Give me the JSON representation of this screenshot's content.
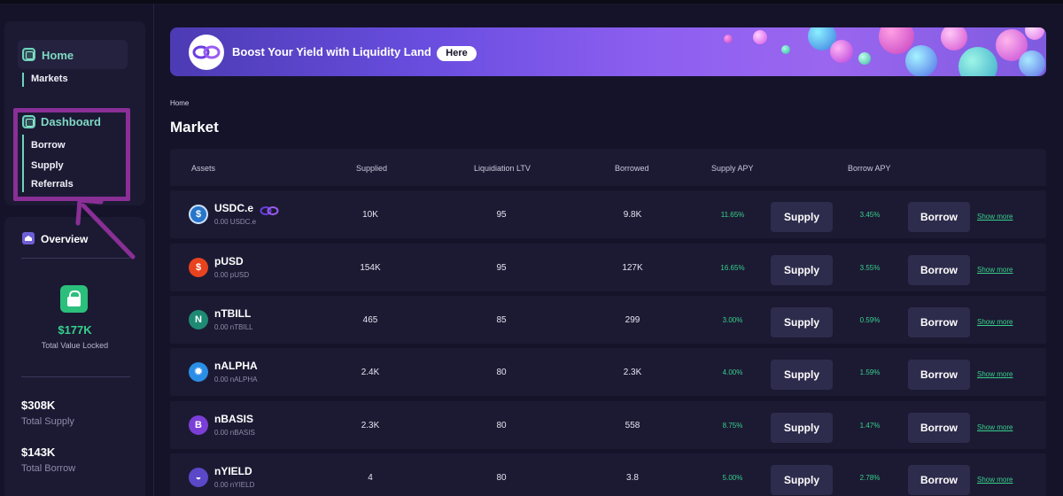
{
  "sidebar": {
    "nav": {
      "home_label": "Home",
      "markets_label": "Markets",
      "dashboard_label": "Dashboard",
      "borrow_label": "Borrow",
      "supply_label": "Supply",
      "referrals_label": "Referrals"
    },
    "overview": {
      "title": "Overview",
      "tvl_value": "$177K",
      "tvl_label": "Total Value Locked",
      "total_supply_value": "$308K",
      "total_supply_label": "Total Supply",
      "total_borrow_value": "$143K",
      "total_borrow_label": "Total Borrow"
    }
  },
  "banner": {
    "text": "Boost Your Yield with Liquidity Land",
    "button_label": "Here"
  },
  "breadcrumb": "Home",
  "page_title": "Market",
  "table": {
    "headers": {
      "assets": "Assets",
      "supplied": "Supplied",
      "ltv": "Liquidiation LTV",
      "borrowed": "Borrowed",
      "supply_apy": "Supply APY",
      "borrow_apy": "Borrow APY"
    },
    "supply_btn": "Supply",
    "borrow_btn": "Borrow",
    "show_more": "Show more",
    "rows": [
      {
        "name": "USDC.e",
        "balance": "0.00 USDC.e",
        "supplied": "10K",
        "ltv": "95",
        "borrowed": "9.8K",
        "supply_apy": "11.65%",
        "borrow_apy": "3.45%",
        "icon": "usdc-icon",
        "color": "#2775ca"
      },
      {
        "name": "pUSD",
        "balance": "0.00 pUSD",
        "supplied": "154K",
        "ltv": "95",
        "borrowed": "127K",
        "supply_apy": "16.65%",
        "borrow_apy": "3.55%",
        "icon": "dollar-icon",
        "color": "#e8431f"
      },
      {
        "name": "nTBILL",
        "balance": "0.00 nTBILL",
        "supplied": "465",
        "ltv": "85",
        "borrowed": "299",
        "supply_apy": "3.00%",
        "borrow_apy": "0.59%",
        "icon": "nest-icon",
        "color": "#1f8a74"
      },
      {
        "name": "nALPHA",
        "balance": "0.00 nALPHA",
        "supplied": "2.4K",
        "ltv": "80",
        "borrowed": "2.3K",
        "supply_apy": "4.00%",
        "borrow_apy": "1.59%",
        "icon": "sun-icon",
        "color": "#2a8ee6"
      },
      {
        "name": "nBASIS",
        "balance": "0.00 nBASIS",
        "supplied": "2.3K",
        "ltv": "80",
        "borrowed": "558",
        "supply_apy": "8.75%",
        "borrow_apy": "1.47%",
        "icon": "b-icon",
        "color": "#7b3fd8"
      },
      {
        "name": "nYIELD",
        "balance": "0.00 nYIELD",
        "supplied": "4",
        "ltv": "80",
        "borrowed": "3.8",
        "supply_apy": "5.00%",
        "borrow_apy": "2.78%",
        "icon": "drop-icon",
        "color": "#5a48c8"
      }
    ]
  },
  "colors": {
    "accent_green": "#36d08b",
    "nav_teal": "#7ed8c4",
    "highlight": "#8a2f96",
    "background": "#15132a",
    "card": "#1c1a33"
  }
}
